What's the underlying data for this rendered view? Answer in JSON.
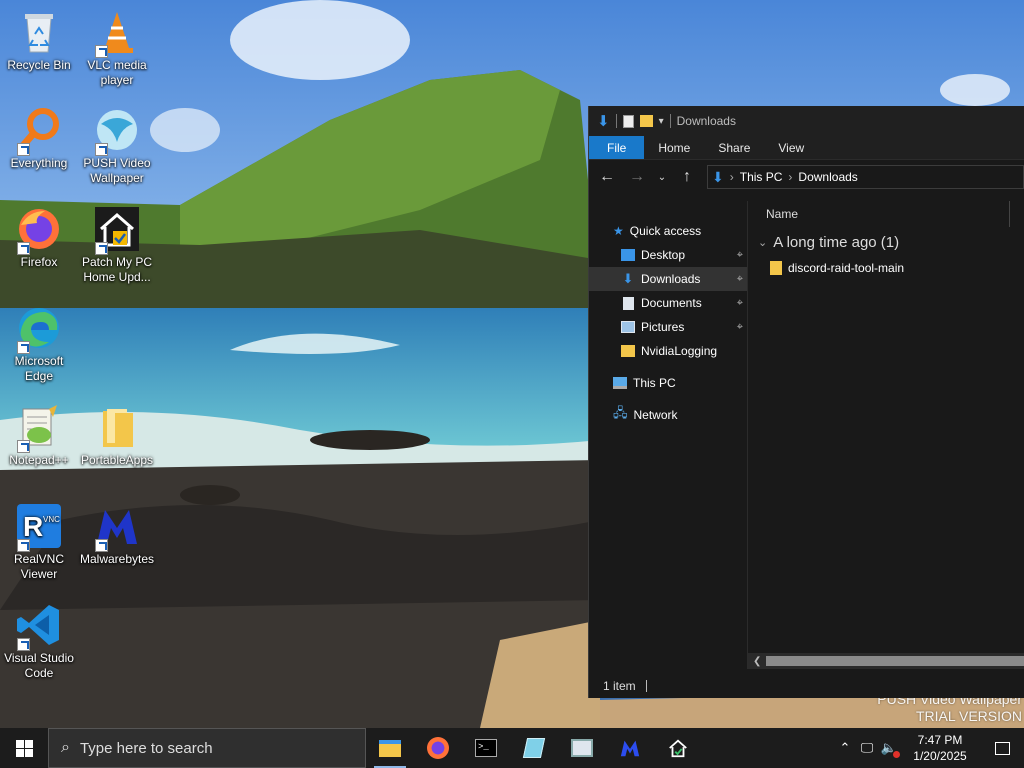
{
  "desktop": {
    "icons": [
      {
        "label": "Recycle Bin"
      },
      {
        "label": "VLC media player"
      },
      {
        "label": "Everything"
      },
      {
        "label": "PUSH Video Wallpaper"
      },
      {
        "label": "Firefox"
      },
      {
        "label": "Patch My PC Home Upd..."
      },
      {
        "label": "Microsoft Edge"
      },
      {
        "label": "Notepad++"
      },
      {
        "label": "PortableApps"
      },
      {
        "label": "RealVNC Viewer"
      },
      {
        "label": "Malwarebytes"
      },
      {
        "label": "Visual Studio Code"
      }
    ],
    "watermark": {
      "line1": "PUSH Video Wallpaper",
      "line2": "TRIAL VERSION"
    }
  },
  "explorer": {
    "title": "Downloads",
    "ribbon_tabs": [
      "File",
      "Home",
      "Share",
      "View"
    ],
    "address": {
      "crumbs": [
        "This PC",
        "Downloads"
      ]
    },
    "nav": {
      "quick_access": "Quick access",
      "pinned": [
        "Desktop",
        "Downloads",
        "Documents",
        "Pictures"
      ],
      "other": "NvidiaLogging",
      "this_pc": "This PC",
      "network": "Network"
    },
    "column_name": "Name",
    "group_label": "A long time ago (1)",
    "files": [
      "discord-raid-tool-main"
    ],
    "status": "1 item"
  },
  "taskbar": {
    "search_placeholder": "Type here to search",
    "time": "7:47 PM",
    "date": "1/20/2025"
  },
  "colors": {
    "accent": "#1979ca",
    "taskbar": "#1c1c1c",
    "window_bg": "#191919"
  }
}
